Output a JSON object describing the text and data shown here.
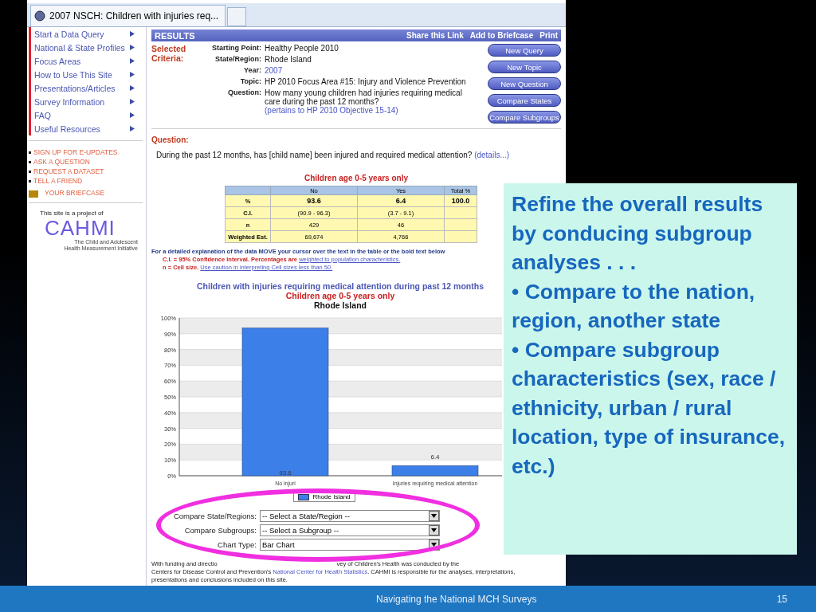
{
  "browser_tab": {
    "title": "2007 NSCH: Children with injuries req..."
  },
  "sidebar": {
    "nav": [
      {
        "label": "Start a Data Query"
      },
      {
        "label": "National & State Profiles"
      },
      {
        "label": "Focus Areas"
      },
      {
        "label": "How to Use This Site"
      },
      {
        "label": "Presentations/Articles"
      },
      {
        "label": "Survey Information"
      },
      {
        "label": "FAQ"
      },
      {
        "label": "Useful Resources"
      }
    ],
    "links": [
      "SIGN UP FOR E-UPDATES",
      "ASK A QUESTION",
      "REQUEST A DATASET",
      "TELL A FRIEND"
    ],
    "briefcase": "YOUR BRIEFCASE",
    "project_note": "This site is a project of",
    "logo": {
      "name": "CAHMI",
      "line_1": "The Child and Adolescent",
      "line_2": "Health Measurement Initiative"
    }
  },
  "results": {
    "title": "RESULTS",
    "actions": [
      "Share this Link",
      "Add to Briefcase",
      "Print"
    ],
    "criteria_label": "Selected Criteria:",
    "criteria": [
      {
        "label": "Starting Point:",
        "value": "Healthy People 2010"
      },
      {
        "label": "State/Region:",
        "value": "Rhode Island"
      },
      {
        "label": "Year:",
        "link": "2007"
      },
      {
        "label": "Topic:",
        "value": "HP 2010 Focus Area #15: Injury and Violence Prevention"
      },
      {
        "label": "Question:",
        "value": "How many young children had injuries requiring medical care during the past 12 months?",
        "link": "(pertains to HP 2010 Objective 15-14)"
      }
    ],
    "buttons": [
      "New Query",
      "New Topic",
      "New Question",
      "Compare States",
      "Compare Subgroups"
    ]
  },
  "question": {
    "heading": "Question:",
    "text": "During the past 12 months, has [child name] been injured and required medical attention?",
    "link": "(details...)"
  },
  "table": {
    "title": "Children age 0-5 years only",
    "columns": [
      "No",
      "Yes",
      "Total %"
    ],
    "rows": [
      {
        "label": "%",
        "cells": [
          "93.6",
          "6.4",
          "100.0"
        ]
      },
      {
        "label": "C.I.",
        "cells": [
          "(90.9 - 96.3)",
          "(3.7 - 9.1)",
          ""
        ]
      },
      {
        "label": "n",
        "cells": [
          "429",
          "46",
          ""
        ]
      },
      {
        "label": "Weighted Est.",
        "cells": [
          "69,674",
          "4,766",
          ""
        ]
      }
    ]
  },
  "notes": {
    "intro": "For a detailed explanation of the data MOVE your cursor over the text in the table or the bold text below",
    "ci": "C.I. = 95% Confidence Interval. Percentages are",
    "ci_link": "weighted to population characteristics.",
    "n": "n = Cell size.",
    "n_link": "Use caution in interpreting Cell sizes less than 50."
  },
  "chart": {
    "title": "Children with injuries requiring medical attention during past 12 months",
    "subtitle": "Children age 0-5 years only",
    "state": "Rhode Island",
    "chart_data": {
      "type": "bar",
      "categories": [
        "No injuri",
        "Injuries requiring medical attention"
      ],
      "series": [
        {
          "name": "Rhode Island",
          "color": "#3d7fe8",
          "values": [
            93.6,
            6.4
          ]
        }
      ],
      "ylim": [
        0,
        100
      ],
      "yticks": [
        {
          "value": 0,
          "label": "0%"
        },
        {
          "value": 10,
          "label": "10%"
        },
        {
          "value": 20,
          "label": "20%"
        },
        {
          "value": 30,
          "label": "30%"
        },
        {
          "value": 40,
          "label": "40%"
        },
        {
          "value": 50,
          "label": "50%"
        },
        {
          "value": 60,
          "label": "60%"
        },
        {
          "value": 70,
          "label": "70%"
        },
        {
          "value": 80,
          "label": "80%"
        },
        {
          "value": 90,
          "label": "90%"
        },
        {
          "value": 100,
          "label": "100%"
        }
      ],
      "grid": true,
      "value_labels": [
        "93.6",
        "6.4"
      ]
    }
  },
  "controls": [
    {
      "label": "Compare State/Regions:",
      "value": "-- Select a State/Region --"
    },
    {
      "label": "Compare Subgroups:",
      "value": "-- Select a Subgroup --"
    },
    {
      "label": "Chart Type:",
      "value": "Bar Chart"
    }
  ],
  "footer": {
    "line_1a": "With funding and directio",
    "line_1b": "vey of Children's Health was conducted by the",
    "line_2a": "Centers for Disease Control and Prevention's",
    "line_2_link": "National Center for Health Statistics",
    "line_2b": ". CAHMI is responsible for the analyses, interpretations,",
    "line_3": "presentations and conclusions included on this site."
  },
  "callout": {
    "intro": "Refine the overall results by conducing subgroup analyses . . .",
    "bullets": [
      "• Compare to the nation, region, another state",
      "• Compare subgroup characteristics (sex, race / ethnicity, urban / rural location, type of insurance, etc.)"
    ]
  },
  "slide_footer": {
    "title": "Navigating the National MCH Surveys",
    "page": "15"
  }
}
